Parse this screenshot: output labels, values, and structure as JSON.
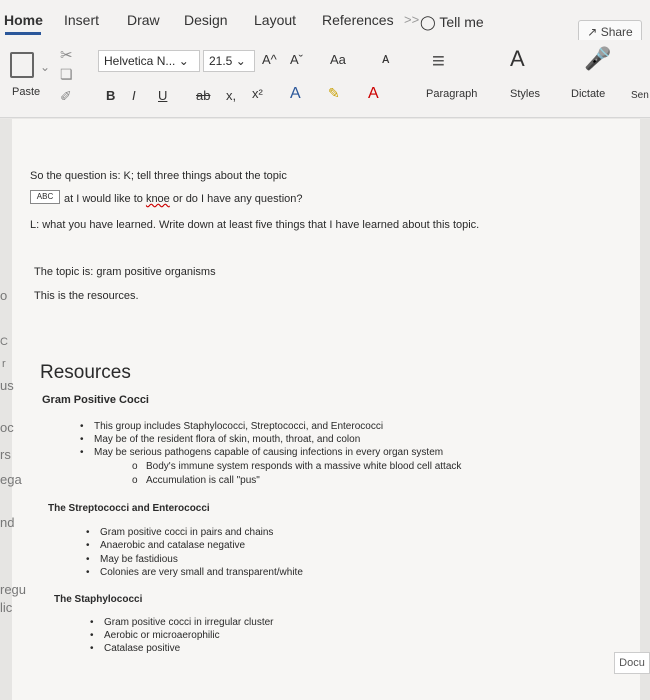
{
  "tabs": {
    "home": "Home",
    "insert": "Insert",
    "draw": "Draw",
    "design": "Design",
    "layout": "Layout",
    "references": "References",
    "more": ">>",
    "tell_me": "Tell me",
    "share": "Share"
  },
  "ribbon": {
    "paste": "Paste",
    "font_name": "Helvetica N...",
    "font_size": "21.5",
    "grow": "A^",
    "shrink": "Aˇ",
    "change_case": "Aa",
    "bold": "B",
    "italic": "I",
    "underline": "U",
    "strike": "ab",
    "subscript": "x,",
    "superscript": "x²",
    "paragraph": "Paragraph",
    "styles": "Styles",
    "dictate": "Dictate",
    "sen": "Sen",
    "docu": "Docu"
  },
  "document": {
    "line1": "So the question is: K; tell three things about the topic",
    "line2_pre": "at I would like to ",
    "line2_word": "knoe",
    "line2_post": " or do I have any question?",
    "line3": "L: what you have learned. Write down at least five things that I have learned about this topic.",
    "topic": "The topic is: gram positive organisms",
    "resources_line": "This is the resources.",
    "heading": "Resources",
    "gpc_title": "Gram Positive Cocci",
    "gpc_b1": "This group includes Staphylococci, Streptococci, and Enterococci",
    "gpc_b2": "May be of the resident flora of skin, mouth, throat, and colon",
    "gpc_b3": "May be serious pathogens capable of causing infections in every organ system",
    "gpc_sub1": "Body's immune system responds with a massive white blood cell attack",
    "gpc_sub2": "Accumulation is call \"pus\"",
    "strep_title": "The Streptococci and Enterococci",
    "strep_b1": "Gram positive cocci in pairs and chains",
    "strep_b2": "Anaerobic and catalase negative",
    "strep_b3": "May be fastidious",
    "strep_b4": "Colonies are very small and transparent/white",
    "staph_title": "The Staphylococci",
    "staph_b1": "Gram positive cocci in irregular cluster",
    "staph_b2": "Aerobic or microaerophilic",
    "staph_b3": "Catalase positive",
    "abc": "ABC"
  },
  "margin": [
    "o",
    "C",
    "r",
    "us",
    "oc",
    "rs",
    "ega",
    "nd",
    "regu",
    "lic"
  ]
}
